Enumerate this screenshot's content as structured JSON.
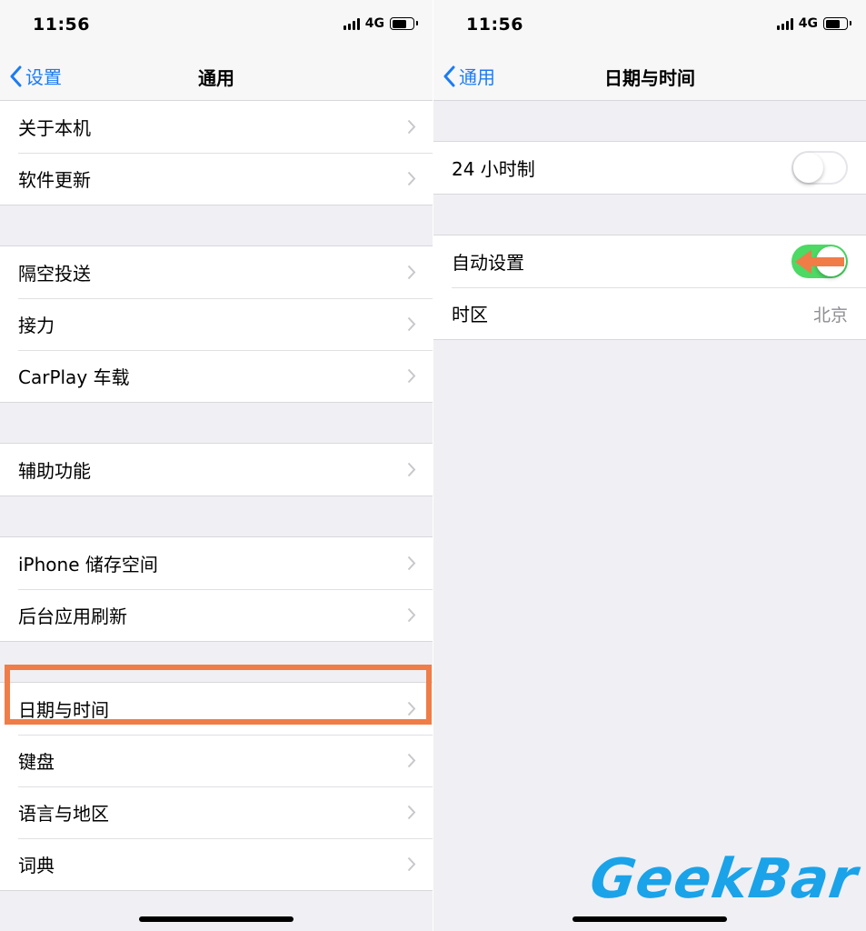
{
  "colors": {
    "accent": "#1b7cf5",
    "highlight": "#f07c47",
    "toggle_on": "#4cd964",
    "background": "#efeff4",
    "watermark": "#1aa3e8"
  },
  "left_screen": {
    "status": {
      "time": "11:56",
      "network": "4G",
      "battery_level": 0.7
    },
    "nav": {
      "back_label": "设置",
      "title": "通用"
    },
    "groups": [
      {
        "items": [
          {
            "label": "关于本机"
          },
          {
            "label": "软件更新"
          }
        ]
      },
      {
        "items": [
          {
            "label": "隔空投送"
          },
          {
            "label": "接力"
          },
          {
            "label": "CarPlay 车载"
          }
        ]
      },
      {
        "items": [
          {
            "label": "辅助功能"
          }
        ]
      },
      {
        "items": [
          {
            "label": "iPhone 储存空间"
          },
          {
            "label": "后台应用刷新"
          }
        ]
      },
      {
        "items": [
          {
            "label": "日期与时间",
            "highlighted": true
          },
          {
            "label": "键盘"
          },
          {
            "label": "语言与地区"
          },
          {
            "label": "词典"
          }
        ]
      }
    ]
  },
  "right_screen": {
    "status": {
      "time": "11:56",
      "network": "4G",
      "battery_level": 0.7
    },
    "nav": {
      "back_label": "通用",
      "title": "日期与时间"
    },
    "groups": [
      {
        "items": [
          {
            "label": "24 小时制",
            "toggle": false
          }
        ]
      },
      {
        "items": [
          {
            "label": "自动设置",
            "toggle": true
          },
          {
            "label": "时区",
            "value": "北京"
          }
        ]
      }
    ]
  },
  "watermark": {
    "text": "GeekBar"
  },
  "icons": {
    "back": "chevron-left-icon",
    "row": "chevron-right-icon",
    "annotation": "arrow-left-icon"
  }
}
